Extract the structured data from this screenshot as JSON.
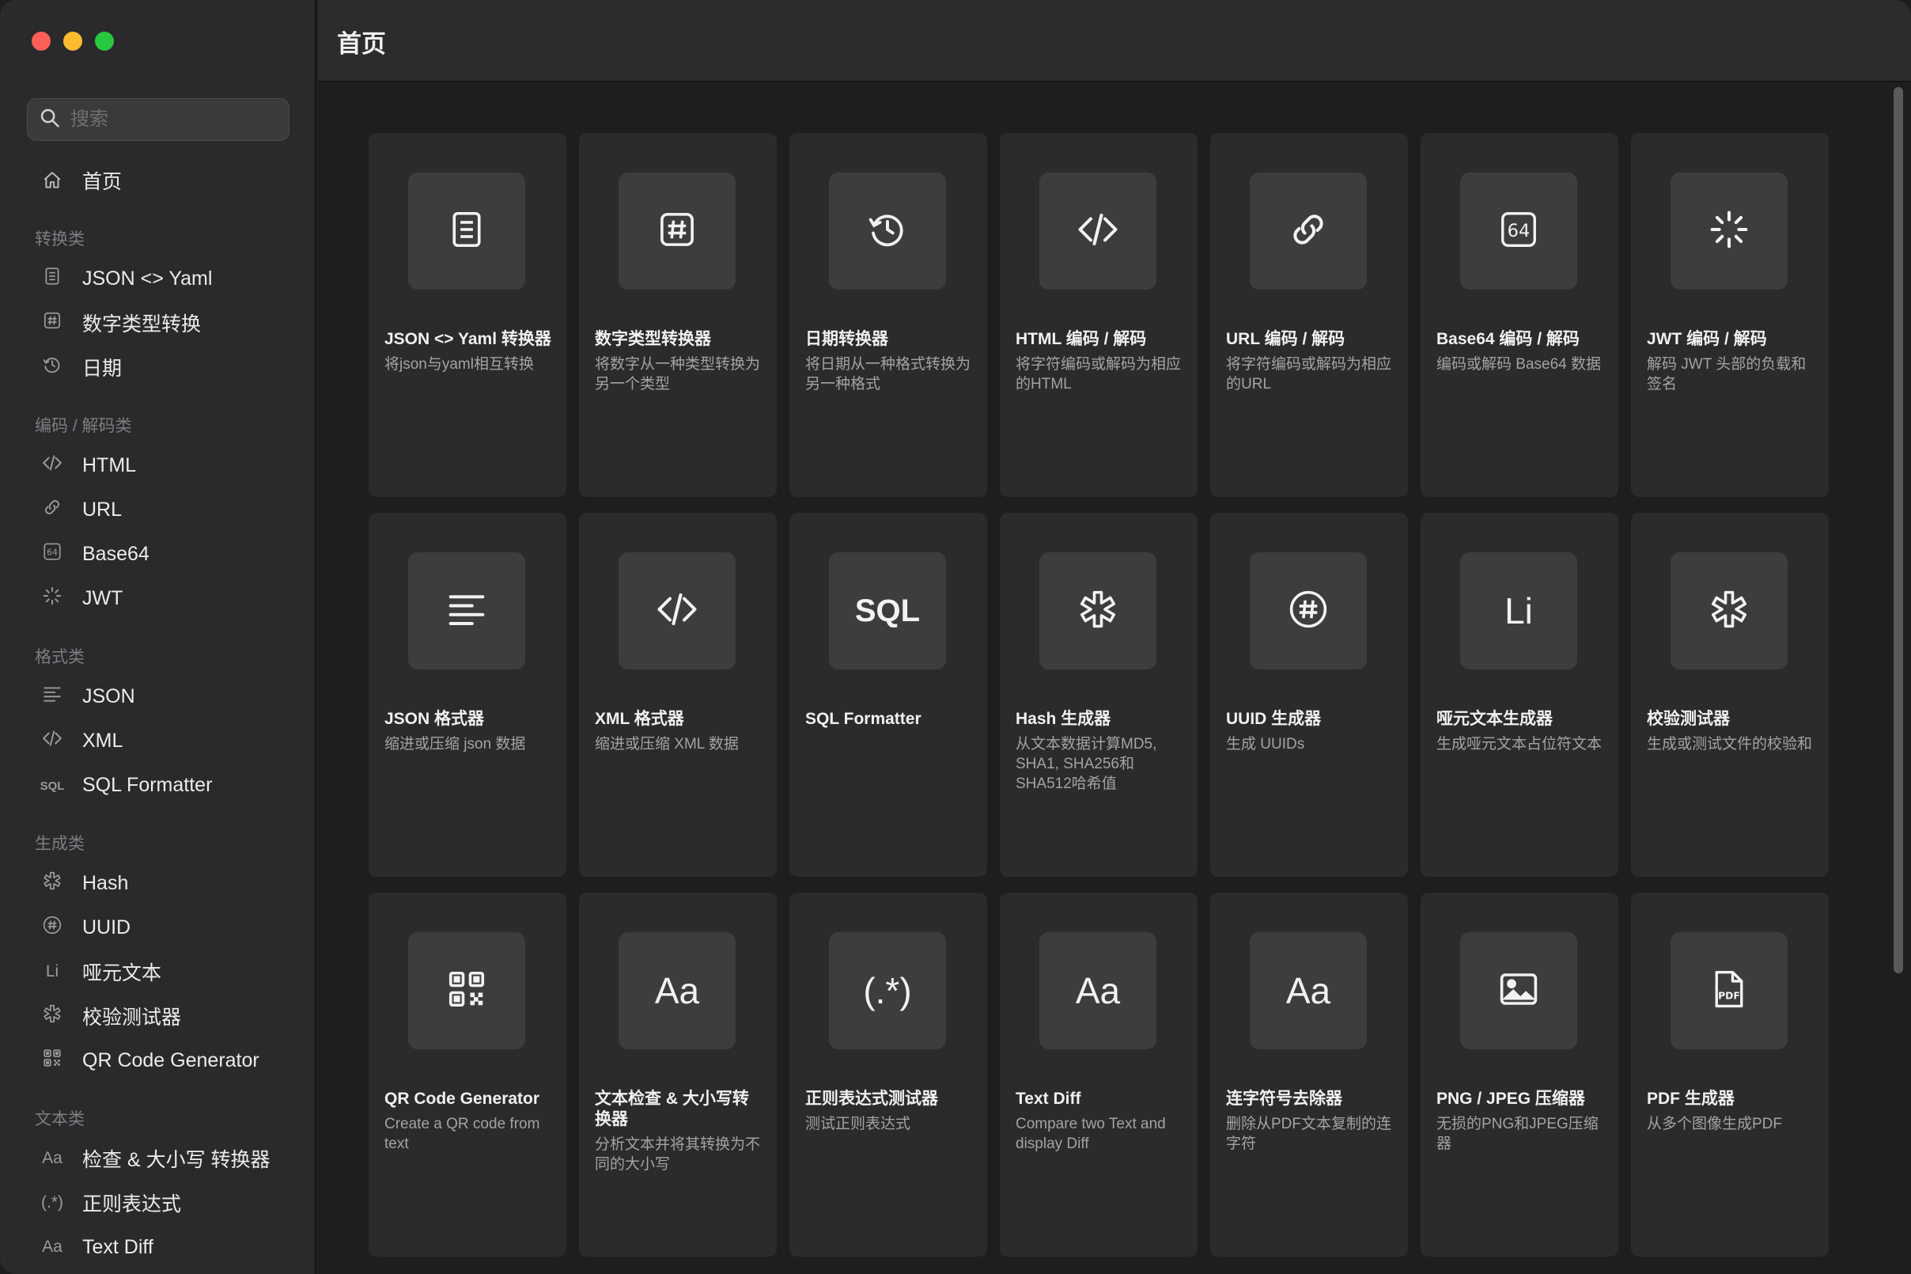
{
  "search": {
    "placeholder": "搜索"
  },
  "header": {
    "title": "首页"
  },
  "sidebar": {
    "home": "首页",
    "sections": [
      {
        "title": "转换类",
        "items": [
          {
            "label": "JSON <> Yaml",
            "icon": "document-icon"
          },
          {
            "label": "数字类型转换",
            "icon": "hash-box-icon"
          },
          {
            "label": "日期",
            "icon": "clock-arrow-icon"
          }
        ]
      },
      {
        "title": "编码 / 解码类",
        "items": [
          {
            "label": "HTML",
            "icon": "code-icon"
          },
          {
            "label": "URL",
            "icon": "link-icon"
          },
          {
            "label": "Base64",
            "icon": "base64-icon"
          },
          {
            "label": "JWT",
            "icon": "spinner-icon"
          }
        ]
      },
      {
        "title": "格式类",
        "items": [
          {
            "label": "JSON",
            "icon": "lines-icon"
          },
          {
            "label": "XML",
            "icon": "code-icon"
          },
          {
            "label": "SQL Formatter",
            "icon": "sql-icon",
            "glyph": "SQL"
          }
        ]
      },
      {
        "title": "生成类",
        "items": [
          {
            "label": "Hash",
            "icon": "asterisk-icon"
          },
          {
            "label": "UUID",
            "icon": "hash-circle-icon"
          },
          {
            "label": "哑元文本",
            "icon": "li-icon",
            "glyph": "Li"
          },
          {
            "label": "校验测试器",
            "icon": "asterisk-icon"
          },
          {
            "label": "QR Code Generator",
            "icon": "qr-icon"
          }
        ]
      },
      {
        "title": "文本类",
        "items": [
          {
            "label": "检查 & 大小写 转换器",
            "icon": "aa-icon",
            "glyph": "Aa"
          },
          {
            "label": "正则表达式",
            "icon": "regex-icon",
            "glyph": "(.*)"
          },
          {
            "label": "Text Diff",
            "icon": "aa-icon",
            "glyph": "Aa"
          }
        ]
      }
    ]
  },
  "cards": [
    {
      "title": "JSON <> Yaml 转换器",
      "desc": "将json与yaml相互转换",
      "icon": "document-icon"
    },
    {
      "title": "数字类型转换器",
      "desc": "将数字从一种类型转换为另一个类型",
      "icon": "hash-box-icon"
    },
    {
      "title": "日期转换器",
      "desc": "将日期从一种格式转换为另一种格式",
      "icon": "clock-arrow-icon"
    },
    {
      "title": "HTML 编码 / 解码",
      "desc": "将字符编码或解码为相应的HTML",
      "icon": "code-icon"
    },
    {
      "title": "URL 编码 / 解码",
      "desc": "将字符编码或解码为相应的URL",
      "icon": "link-icon"
    },
    {
      "title": "Base64 编码 / 解码",
      "desc": "编码或解码 Base64 数据",
      "icon": "base64-icon"
    },
    {
      "title": "JWT 编码 / 解码",
      "desc": "解码 JWT 头部的负载和签名",
      "icon": "spinner-icon"
    },
    {
      "title": "JSON 格式器",
      "desc": "缩进或压缩 json 数据",
      "icon": "lines-icon"
    },
    {
      "title": "XML 格式器",
      "desc": "缩进或压缩 XML 数据",
      "icon": "code-icon"
    },
    {
      "title": "SQL Formatter",
      "desc": "",
      "icon": "sql-icon",
      "glyph": "SQL"
    },
    {
      "title": "Hash 生成器",
      "desc": "从文本数据计算MD5, SHA1, SHA256和SHA512哈希值",
      "icon": "asterisk-icon"
    },
    {
      "title": "UUID 生成器",
      "desc": "生成 UUIDs",
      "icon": "hash-circle-icon"
    },
    {
      "title": "哑元文本生成器",
      "desc": "生成哑元文本占位符文本",
      "icon": "li-icon",
      "glyph": "Li"
    },
    {
      "title": "校验测试器",
      "desc": "生成或测试文件的校验和",
      "icon": "asterisk-icon"
    },
    {
      "title": "QR Code Generator",
      "desc": "Create a QR code from text",
      "icon": "qr-icon"
    },
    {
      "title": "文本检查 & 大小写转换器",
      "desc": "分析文本并将其转换为不同的大小写",
      "icon": "aa-icon",
      "glyph": "Aa"
    },
    {
      "title": "正则表达式测试器",
      "desc": "测试正则表达式",
      "icon": "regex-icon",
      "glyph": "(.*)"
    },
    {
      "title": "Text Diff",
      "desc": "Compare two Text and display Diff",
      "icon": "aa-icon",
      "glyph": "Aa"
    },
    {
      "title": "连字符号去除器",
      "desc": "删除从PDF文本复制的连字符",
      "icon": "aa-icon",
      "glyph": "Aa"
    },
    {
      "title": "PNG / JPEG 压缩器",
      "desc": "无损的PNG和JPEG压缩器",
      "icon": "image-icon"
    },
    {
      "title": "PDF 生成器",
      "desc": "从多个图像生成PDF",
      "icon": "pdf-icon"
    }
  ]
}
